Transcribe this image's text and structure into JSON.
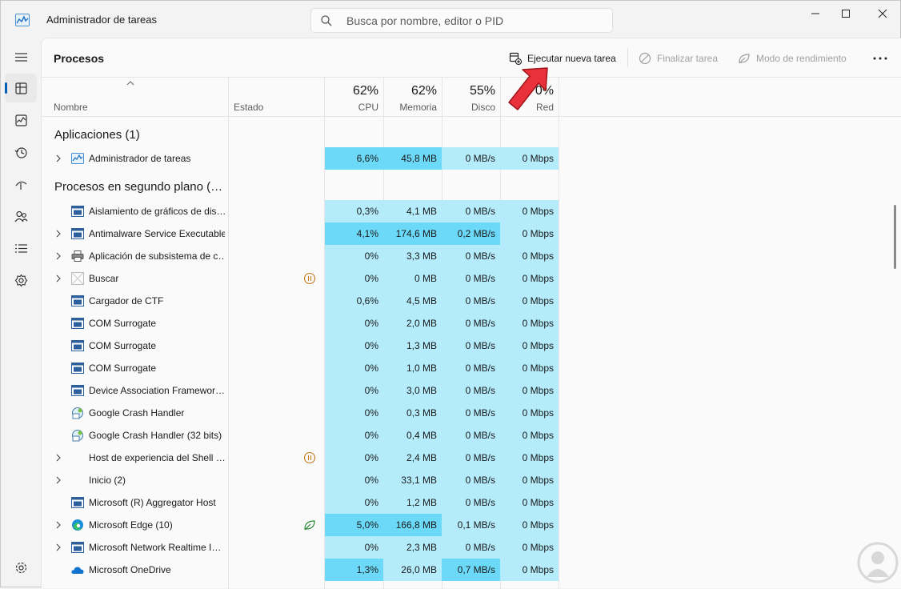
{
  "window": {
    "title": "Administrador de tareas"
  },
  "search": {
    "placeholder": "Busca por nombre, editor o PID"
  },
  "commandbar": {
    "page_title": "Procesos",
    "run_task": "Ejecutar nueva tarea",
    "end_task": "Finalizar tarea",
    "efficiency": "Modo de rendimiento"
  },
  "table": {
    "headers": {
      "name": "Nombre",
      "state": "Estado",
      "cpu_pct": "62%",
      "cpu": "CPU",
      "mem_pct": "62%",
      "mem": "Memoria",
      "disk_pct": "55%",
      "disk": "Disco",
      "net_pct": "0%",
      "net": "Red"
    },
    "group_apps": "Aplicaciones (1)",
    "group_bg": "Procesos en segundo plano (…",
    "apps": [
      {
        "name": "Administrador de tareas",
        "cpu": "6,6%",
        "mem": "45,8 MB",
        "disk": "0 MB/s",
        "net": "0 Mbps"
      }
    ],
    "background": [
      {
        "name": "Aislamiento de gráficos de dis…",
        "cpu": "0,3%",
        "mem": "4,1 MB",
        "disk": "0 MB/s",
        "net": "0 Mbps"
      },
      {
        "name": "Antimalware Service Executable",
        "cpu": "4,1%",
        "mem": "174,6 MB",
        "disk": "0,2 MB/s",
        "net": "0 Mbps"
      },
      {
        "name": "Aplicación de subsistema de c…",
        "cpu": "0%",
        "mem": "3,3 MB",
        "disk": "0 MB/s",
        "net": "0 Mbps"
      },
      {
        "name": "Buscar",
        "cpu": "0%",
        "mem": "0 MB",
        "disk": "0 MB/s",
        "net": "0 Mbps"
      },
      {
        "name": "Cargador de CTF",
        "cpu": "0,6%",
        "mem": "4,5 MB",
        "disk": "0 MB/s",
        "net": "0 Mbps"
      },
      {
        "name": "COM Surrogate",
        "cpu": "0%",
        "mem": "2,0 MB",
        "disk": "0 MB/s",
        "net": "0 Mbps"
      },
      {
        "name": "COM Surrogate",
        "cpu": "0%",
        "mem": "1,3 MB",
        "disk": "0 MB/s",
        "net": "0 Mbps"
      },
      {
        "name": "COM Surrogate",
        "cpu": "0%",
        "mem": "1,0 MB",
        "disk": "0 MB/s",
        "net": "0 Mbps"
      },
      {
        "name": "Device Association Framewor…",
        "cpu": "0%",
        "mem": "3,0 MB",
        "disk": "0 MB/s",
        "net": "0 Mbps"
      },
      {
        "name": "Google Crash Handler",
        "cpu": "0%",
        "mem": "0,3 MB",
        "disk": "0 MB/s",
        "net": "0 Mbps"
      },
      {
        "name": "Google Crash Handler (32 bits)",
        "cpu": "0%",
        "mem": "0,4 MB",
        "disk": "0 MB/s",
        "net": "0 Mbps"
      },
      {
        "name": "Host de experiencia del Shell …",
        "cpu": "0%",
        "mem": "2,4 MB",
        "disk": "0 MB/s",
        "net": "0 Mbps"
      },
      {
        "name": "Inicio (2)",
        "cpu": "0%",
        "mem": "33,1 MB",
        "disk": "0 MB/s",
        "net": "0 Mbps"
      },
      {
        "name": "Microsoft (R) Aggregator Host",
        "cpu": "0%",
        "mem": "1,2 MB",
        "disk": "0 MB/s",
        "net": "0 Mbps"
      },
      {
        "name": "Microsoft Edge (10)",
        "cpu": "5,0%",
        "mem": "166,8 MB",
        "disk": "0,1 MB/s",
        "net": "0 Mbps"
      },
      {
        "name": "Microsoft Network Realtime I…",
        "cpu": "0%",
        "mem": "2,3 MB",
        "disk": "0 MB/s",
        "net": "0 Mbps"
      },
      {
        "name": "Microsoft OneDrive",
        "cpu": "1,3%",
        "mem": "26,0 MB",
        "disk": "0,7 MB/s",
        "net": "0 Mbps"
      }
    ]
  },
  "colors": {
    "accent": "#005fb8",
    "heat_low": "#b4ecfc",
    "heat_high": "#6bd9f7",
    "arrow": "#e8313a"
  }
}
